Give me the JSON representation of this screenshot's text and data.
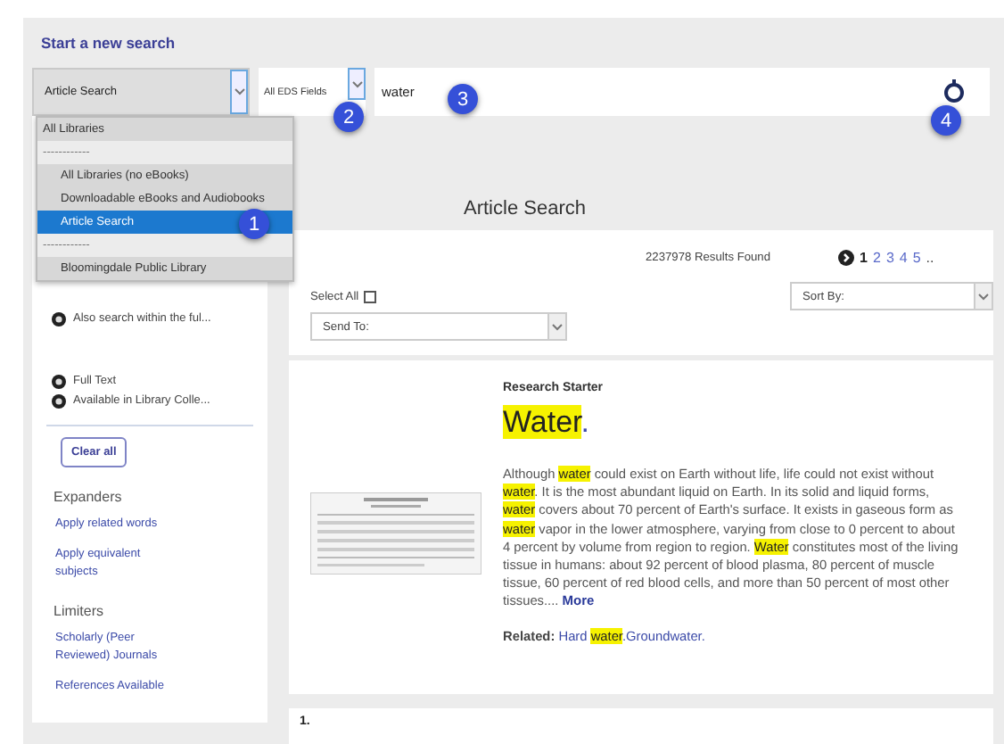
{
  "header": {
    "title": "Start a new search"
  },
  "search": {
    "source": "Article Search",
    "field": "All EDS Fields",
    "query": "water"
  },
  "source_menu": {
    "expanded": true,
    "items": [
      {
        "kind": "header",
        "label": "All Libraries",
        "selected": false
      },
      {
        "kind": "separator",
        "label": "------------",
        "selected": false
      },
      {
        "kind": "option",
        "label": "All Libraries (no eBooks)",
        "selected": false
      },
      {
        "kind": "option",
        "label": "Downloadable eBooks and Audiobooks",
        "selected": false
      },
      {
        "kind": "option",
        "label": "Article Search",
        "selected": true
      },
      {
        "kind": "separator",
        "label": "------------",
        "selected": false
      },
      {
        "kind": "option",
        "label": "Bloomingdale Public Library",
        "selected": false
      }
    ]
  },
  "callouts": [
    "1",
    "2",
    "3",
    "4"
  ],
  "sidebar": {
    "applied": [
      [
        "Also search within the ful..."
      ],
      [
        "Full Text",
        "Available in Library Colle..."
      ]
    ],
    "clear_button": "Clear all",
    "sections": [
      {
        "title": "Expanders",
        "links": [
          "Apply related words",
          "Apply equivalent subjects"
        ]
      },
      {
        "title": "Limiters",
        "links": [
          "Scholarly (Peer Reviewed) Journals",
          "References Available"
        ]
      }
    ]
  },
  "results": {
    "heading": "Article Search",
    "count": "2237978 Results Found",
    "pages": [
      {
        "label": "1",
        "selected": true
      },
      {
        "label": "2",
        "selected": false
      },
      {
        "label": "3",
        "selected": false
      },
      {
        "label": "4",
        "selected": false
      },
      {
        "label": "5",
        "selected": false
      }
    ],
    "more_pages": "..",
    "select_all": {
      "label": "Select All",
      "checked": false
    },
    "sort": "Sort By:",
    "send_to": "Send To:"
  },
  "research_starter": {
    "label": "Research Starter",
    "title": [
      {
        "text": "Water",
        "highlight": true
      },
      {
        "text": ".",
        "highlight": false
      }
    ],
    "summary": [
      {
        "text": "Although ",
        "highlight": false
      },
      {
        "text": "water",
        "highlight": true
      },
      {
        "text": " could exist on Earth without life, life could not exist without ",
        "highlight": false
      },
      {
        "text": "water",
        "highlight": true
      },
      {
        "text": ". It is the most abundant liquid on Earth. In its solid and liquid forms, ",
        "highlight": false
      },
      {
        "text": "water",
        "highlight": true
      },
      {
        "text": " covers about 70 percent of Earth's surface. It exists in gaseous form as ",
        "highlight": false
      },
      {
        "text": "water",
        "highlight": true
      },
      {
        "text": " vapor in the lower atmosphere, varying from close to 0 percent to about 4 percent by volume from region to region. ",
        "highlight": false
      },
      {
        "text": "Water",
        "highlight": true
      },
      {
        "text": " constitutes most of the living tissue in humans: about 92 percent of blood plasma, 80 percent of muscle tissue, 60 percent of red blood cells, and more than 50 percent of most other tissues....",
        "highlight": false
      }
    ],
    "more": "More",
    "related_label": "Related:",
    "related": [
      {
        "text": "Hard ",
        "highlight": false
      },
      {
        "text": "water",
        "highlight": true
      },
      {
        "text": ".Groundwater.",
        "highlight": false
      }
    ]
  },
  "first_result": {
    "number": "1."
  }
}
